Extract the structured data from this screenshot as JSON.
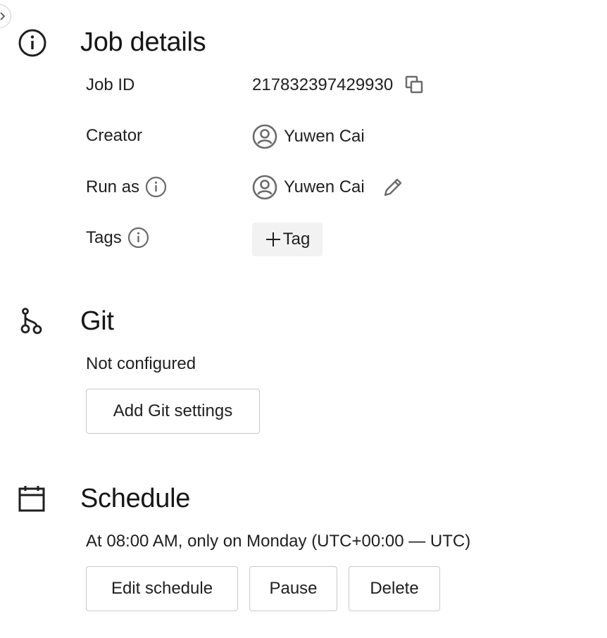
{
  "job_details": {
    "title": "Job details",
    "icon": "info-icon",
    "rows": {
      "job_id": {
        "label": "Job ID",
        "value": "217832397429930"
      },
      "creator": {
        "label": "Creator",
        "value": "Yuwen Cai"
      },
      "run_as": {
        "label": "Run as",
        "value": "Yuwen Cai"
      },
      "tags": {
        "label": "Tags",
        "add_label": "Tag"
      }
    }
  },
  "git": {
    "title": "Git",
    "icon": "git-branch-icon",
    "status": "Not configured",
    "add_button": "Add Git settings"
  },
  "schedule": {
    "title": "Schedule",
    "icon": "calendar-icon",
    "description": "At 08:00 AM, only on Monday (UTC+00:00 — UTC)",
    "buttons": {
      "edit": "Edit schedule",
      "pause": "Pause",
      "delete": "Delete"
    }
  },
  "colors": {
    "text": "#1f1f1f",
    "icon": "#6b6b6b",
    "border": "#c9c9c9",
    "tag_bg": "#f2f2f2"
  }
}
